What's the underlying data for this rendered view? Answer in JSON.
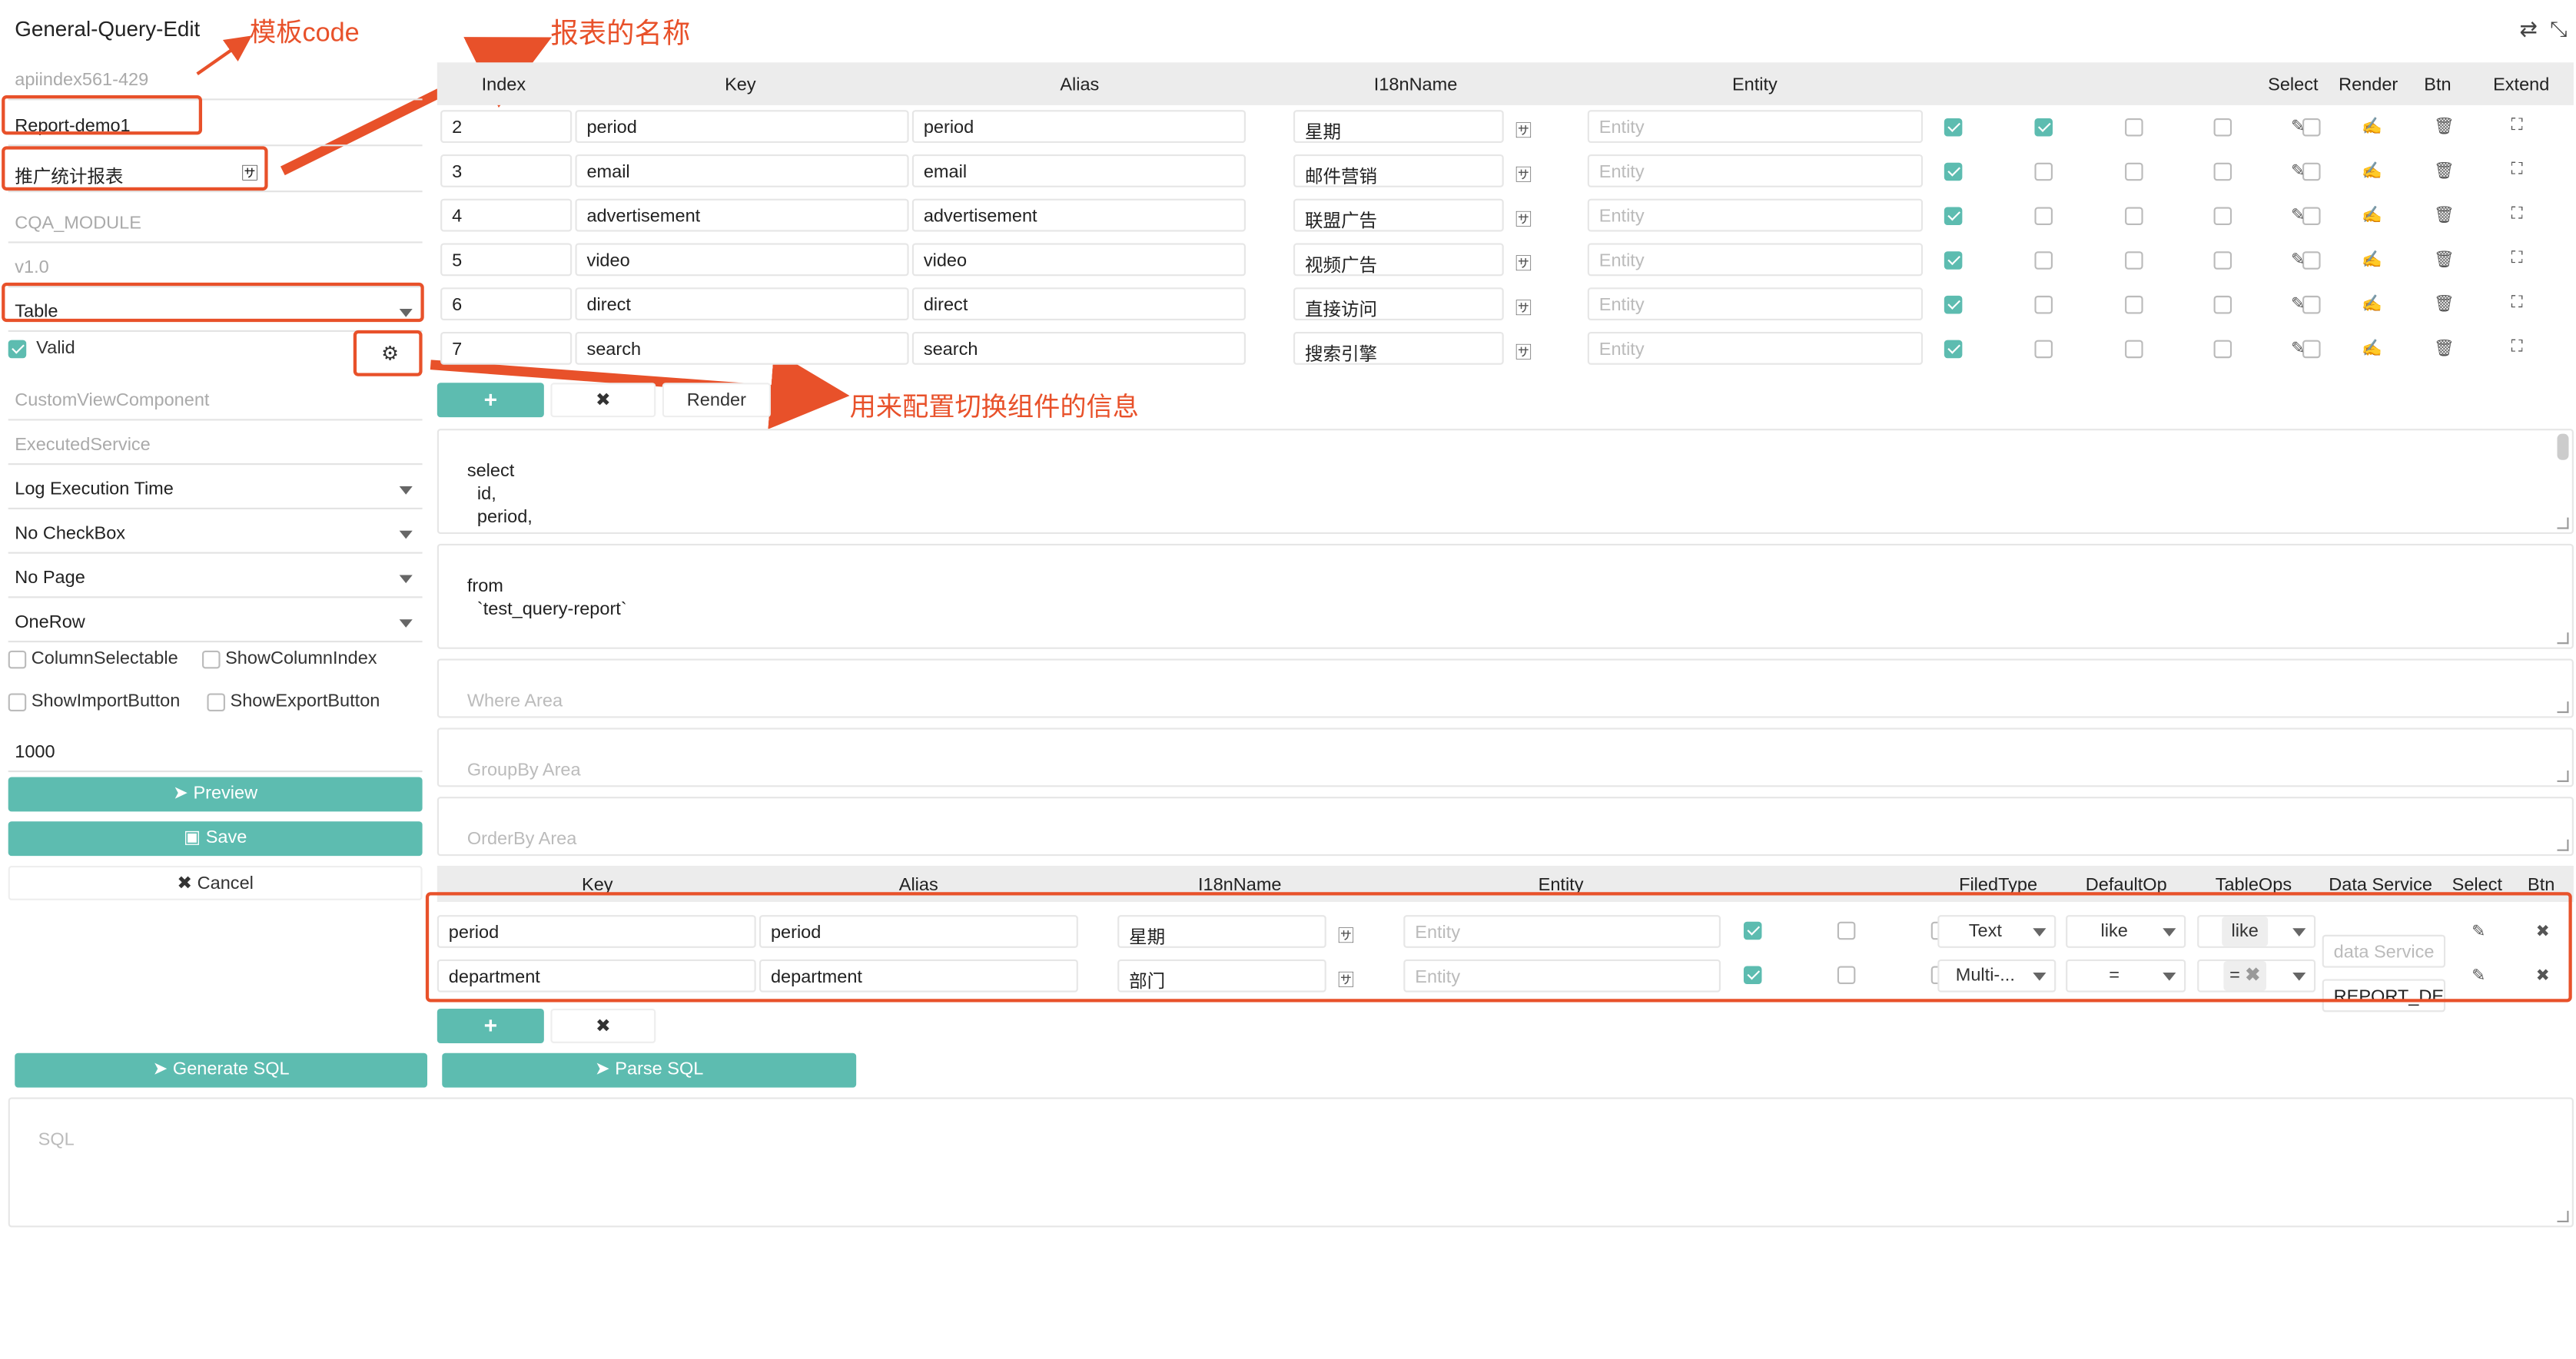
{
  "app_title": "General-Query-Edit",
  "annotations": {
    "template_code": "模板code",
    "report_name": "报表的名称",
    "switch_config": "用来配置切换组件的信息"
  },
  "left": {
    "api_index": "apiindex561-429",
    "report_code": "Report-demo1",
    "report_name": "推广统计报表",
    "module": "CQA_MODULE",
    "version": "v1.0",
    "view_type": "Table",
    "valid_label": "Valid",
    "custom_view_component_ph": "CustomViewComponent",
    "executed_service_ph": "ExecutedService",
    "log_exec": "Log Execution Time",
    "checkbox_mode": "No CheckBox",
    "page_mode": "No Page",
    "row_mode": "OneRow",
    "column_selectable": "ColumnSelectable",
    "show_column_index": "ShowColumnIndex",
    "show_import": "ShowImportButton",
    "show_export": "ShowExportButton",
    "limit": "1000",
    "preview": "Preview",
    "save": "Save",
    "cancel": "Cancel",
    "generate_sql": "Generate SQL",
    "parse_sql": "Parse SQL",
    "sql_ph": "SQL"
  },
  "columns_table": {
    "headers": [
      "Index",
      "Key",
      "Alias",
      "I18nName",
      "Entity",
      "Select",
      "Render",
      "Btn",
      "Extend"
    ],
    "entity_ph": "Entity",
    "rows": [
      {
        "index": "2",
        "key": "period",
        "alias": "period",
        "i18n": "星期",
        "c1": true,
        "c2": true
      },
      {
        "index": "3",
        "key": "email",
        "alias": "email",
        "i18n": "邮件营销",
        "c1": true,
        "c2": false
      },
      {
        "index": "4",
        "key": "advertisement",
        "alias": "advertisement",
        "i18n": "联盟广告",
        "c1": true,
        "c2": false
      },
      {
        "index": "5",
        "key": "video",
        "alias": "video",
        "i18n": "视频广告",
        "c1": true,
        "c2": false
      },
      {
        "index": "6",
        "key": "direct",
        "alias": "direct",
        "i18n": "直接访问",
        "c1": true,
        "c2": false
      },
      {
        "index": "7",
        "key": "search",
        "alias": "search",
        "i18n": "搜索引擎",
        "c1": true,
        "c2": false
      }
    ],
    "add": "+",
    "remove": "✖",
    "render": "Render"
  },
  "sql": {
    "select": "select\n      id,\n      period,\n      email,\n      advertisement,",
    "from": "from\n      `test_query-report`",
    "where_ph": "Where Area",
    "groupby_ph": "GroupBy Area",
    "orderby_ph": "OrderBy Area"
  },
  "conditions_table": {
    "headers": [
      "Key",
      "Alias",
      "I18nName",
      "Entity",
      "FiledType",
      "DefaultOp",
      "TableOps",
      "Data Service",
      "Select",
      "Btn"
    ],
    "entity_ph": "Entity",
    "data_service_ph": "data Service",
    "rows": [
      {
        "key": "period",
        "alias": "period",
        "i18n": "星期",
        "c1": true,
        "filed_type": "Text",
        "default_op": "like",
        "table_ops": "like",
        "data_service": ""
      },
      {
        "key": "department",
        "alias": "department",
        "i18n": "部门",
        "c1": true,
        "filed_type": "Multi-...",
        "default_op": "=",
        "table_ops": "=",
        "data_service": "REPORT_DE"
      }
    ],
    "add": "+",
    "remove": "✖"
  }
}
